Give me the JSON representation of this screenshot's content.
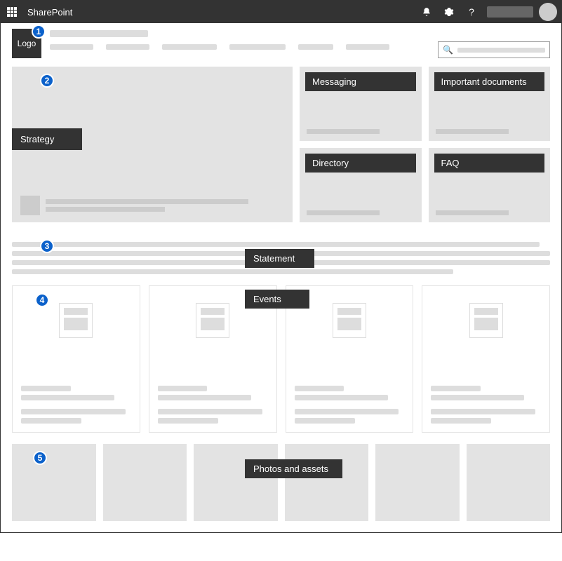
{
  "topbar": {
    "app_name": "SharePoint"
  },
  "header": {
    "logo_text": "Logo"
  },
  "callouts": {
    "c1": "1",
    "c2": "2",
    "c3": "3",
    "c4": "4",
    "c5": "5"
  },
  "hero": {
    "label": "Strategy"
  },
  "tiles": {
    "t1": "Messaging",
    "t2": "Important documents",
    "t3": "Directory",
    "t4": "FAQ"
  },
  "statement": {
    "label": "Statement"
  },
  "events": {
    "label": "Events"
  },
  "photos": {
    "label": "Photos and assets"
  }
}
